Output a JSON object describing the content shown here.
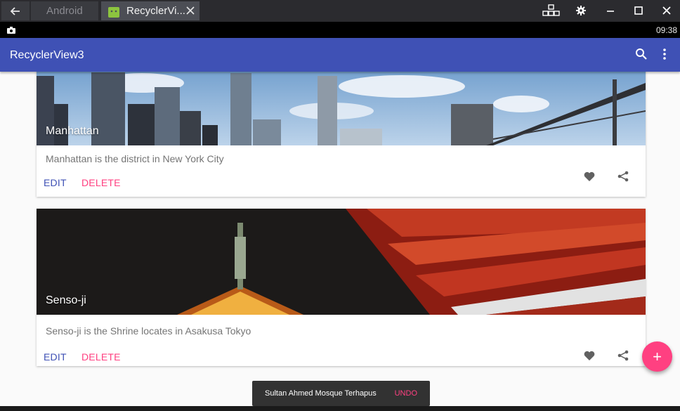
{
  "window": {
    "tabs": [
      {
        "label": "Android"
      },
      {
        "label": "RecyclerVi..."
      }
    ]
  },
  "status": {
    "time": "09:38"
  },
  "appbar": {
    "title": "RecyclerView3"
  },
  "cards": [
    {
      "title": "Manhattan",
      "description": "Manhattan is the district in New York City",
      "edit_label": "EDIT",
      "delete_label": "DELETE"
    },
    {
      "title": "Senso-ji",
      "description": "Senso-ji is the Shrine locates in Asakusa Tokyo",
      "edit_label": "EDIT",
      "delete_label": "DELETE"
    }
  ],
  "fab": {
    "icon": "+"
  },
  "snackbar": {
    "message": "Sultan Ahmed Mosque Terhapus",
    "action": "UNDO"
  },
  "colors": {
    "primary": "#3f51b5",
    "accent": "#ff4081"
  }
}
